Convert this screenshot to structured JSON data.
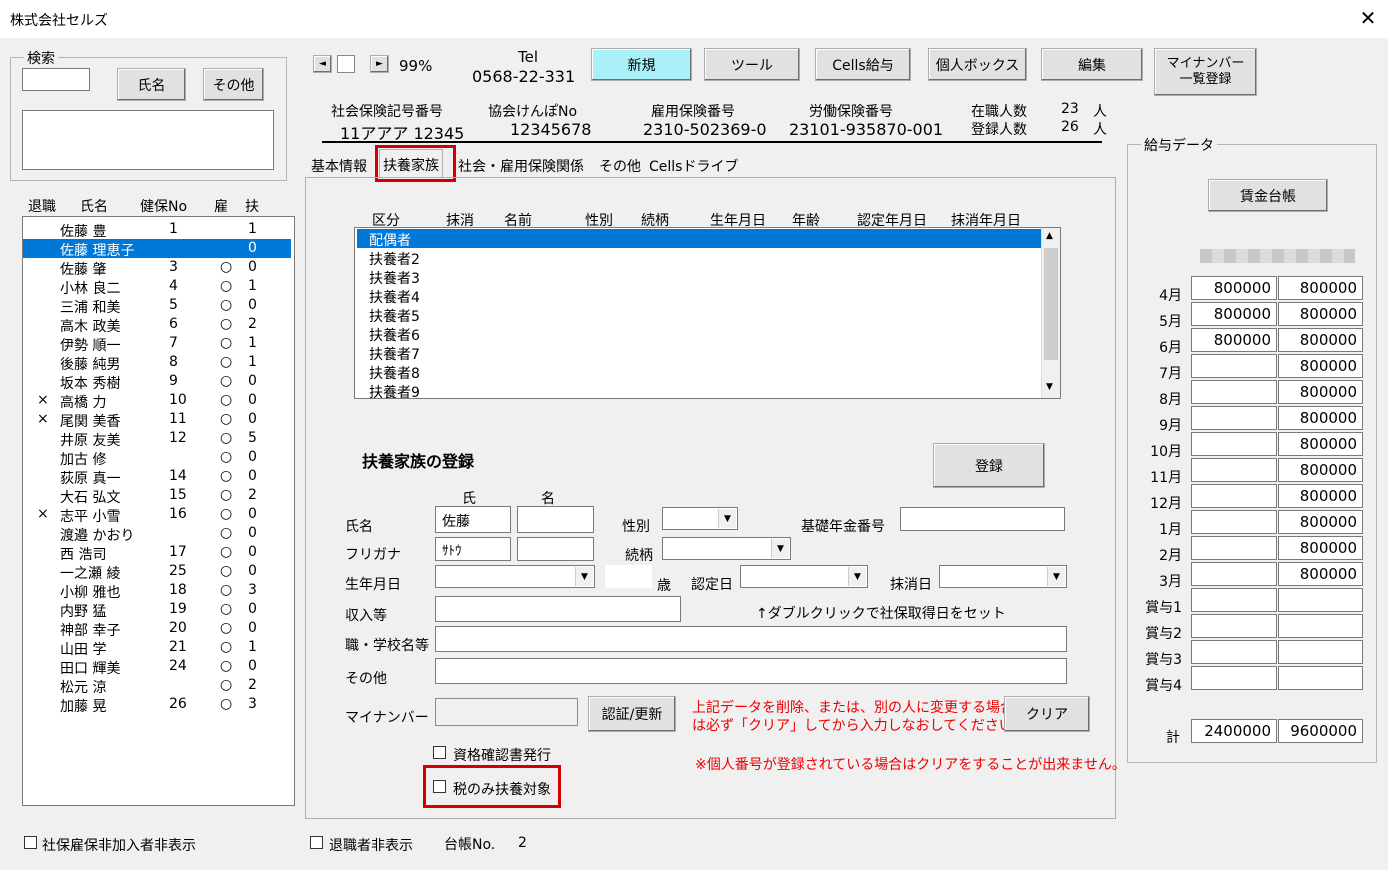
{
  "window": {
    "title": "株式会社セルズ",
    "close": "✕"
  },
  "search": {
    "legend": "検索",
    "value": "",
    "name_btn": "氏名",
    "other_btn": "その他",
    "memo": ""
  },
  "employee_list": {
    "headers": [
      "退職",
      "氏名",
      "健保No",
      "雇",
      "扶"
    ],
    "rows": [
      {
        "ret": "",
        "name": "佐藤 豊",
        "no": "1",
        "emp": "",
        "dep": "1",
        "sel": false
      },
      {
        "ret": "",
        "name": "佐藤 理恵子",
        "no": "",
        "emp": "",
        "dep": "0",
        "sel": true
      },
      {
        "ret": "",
        "name": "佐藤 肇",
        "no": "3",
        "emp": "○",
        "dep": "0",
        "sel": false
      },
      {
        "ret": "",
        "name": "小林 良二",
        "no": "4",
        "emp": "○",
        "dep": "1",
        "sel": false
      },
      {
        "ret": "",
        "name": "三浦 和美",
        "no": "5",
        "emp": "○",
        "dep": "0",
        "sel": false
      },
      {
        "ret": "",
        "name": "高木 政美",
        "no": "6",
        "emp": "○",
        "dep": "2",
        "sel": false
      },
      {
        "ret": "",
        "name": "伊勢 順一",
        "no": "7",
        "emp": "○",
        "dep": "1",
        "sel": false
      },
      {
        "ret": "",
        "name": "後藤 純男",
        "no": "8",
        "emp": "○",
        "dep": "1",
        "sel": false
      },
      {
        "ret": "",
        "name": "坂本 秀樹",
        "no": "9",
        "emp": "○",
        "dep": "0",
        "sel": false
      },
      {
        "ret": "×",
        "name": "高橋 力",
        "no": "10",
        "emp": "○",
        "dep": "0",
        "sel": false
      },
      {
        "ret": "×",
        "name": "尾関 美香",
        "no": "11",
        "emp": "○",
        "dep": "0",
        "sel": false
      },
      {
        "ret": "",
        "name": "井原 友美",
        "no": "12",
        "emp": "○",
        "dep": "5",
        "sel": false
      },
      {
        "ret": "",
        "name": "加古 修",
        "no": "",
        "emp": "○",
        "dep": "0",
        "sel": false
      },
      {
        "ret": "",
        "name": "荻原 真一",
        "no": "14",
        "emp": "○",
        "dep": "0",
        "sel": false
      },
      {
        "ret": "",
        "name": "大石 弘文",
        "no": "15",
        "emp": "○",
        "dep": "2",
        "sel": false
      },
      {
        "ret": "×",
        "name": "志平 小雪",
        "no": "16",
        "emp": "○",
        "dep": "0",
        "sel": false
      },
      {
        "ret": "",
        "name": "渡邉 かおり",
        "no": "",
        "emp": "○",
        "dep": "0",
        "sel": false
      },
      {
        "ret": "",
        "name": "西 浩司",
        "no": "17",
        "emp": "○",
        "dep": "0",
        "sel": false
      },
      {
        "ret": "",
        "name": "一之瀬 綾",
        "no": "25",
        "emp": "○",
        "dep": "0",
        "sel": false
      },
      {
        "ret": "",
        "name": "小柳 雅也",
        "no": "18",
        "emp": "○",
        "dep": "3",
        "sel": false
      },
      {
        "ret": "",
        "name": "内野 猛",
        "no": "19",
        "emp": "○",
        "dep": "0",
        "sel": false
      },
      {
        "ret": "",
        "name": "神部 幸子",
        "no": "20",
        "emp": "○",
        "dep": "0",
        "sel": false
      },
      {
        "ret": "",
        "name": "山田 学",
        "no": "21",
        "emp": "○",
        "dep": "1",
        "sel": false
      },
      {
        "ret": "",
        "name": "田口 輝美",
        "no": "24",
        "emp": "○",
        "dep": "0",
        "sel": false
      },
      {
        "ret": "",
        "name": "松元 涼",
        "no": "",
        "emp": "○",
        "dep": "2",
        "sel": false
      },
      {
        "ret": "",
        "name": "加藤 晃",
        "no": "26",
        "emp": "○",
        "dep": "3",
        "sel": false
      }
    ]
  },
  "nav": {
    "zoom": "99%",
    "left": "◄",
    "right": "►"
  },
  "tel": {
    "label": "Tel",
    "value": "0568-22-331"
  },
  "toolbar": {
    "new": "新規",
    "tools": "ツール",
    "cells": "Cells給与",
    "personal": "個人ボックス",
    "edit": "編集",
    "mynumber_line1": "マイナンバー",
    "mynumber_line2": "一覧登録"
  },
  "info": {
    "social_label": "社会保険記号番号",
    "social_value": "11アアア 12345",
    "kenpo_label": "協会けんぽNo",
    "kenpo_value": "12345678",
    "koyou_label": "雇用保険番号",
    "koyou_value": "2310-502369-0",
    "roudou_label": "労働保険番号",
    "roudou_value": "23101-935870-001",
    "zaishoku_label": "在職人数",
    "zaishoku_value": "23",
    "zaishoku_unit": "人",
    "touroku_label": "登録人数",
    "touroku_value": "26",
    "touroku_unit": "人"
  },
  "tabs": [
    "基本情報",
    "扶養家族",
    "社会・雇用保険関係",
    "その他",
    "Cellsドライブ"
  ],
  "dependents": {
    "headers": [
      "区分",
      "抹消",
      "名前",
      "性別",
      "続柄",
      "生年月日",
      "年齢",
      "認定年月日",
      "抹消年月日"
    ],
    "rows": [
      "配偶者",
      "扶養者2",
      "扶養者3",
      "扶養者4",
      "扶養者5",
      "扶養者6",
      "扶養者7",
      "扶養者8",
      "扶養者9"
    ]
  },
  "register": {
    "heading": "扶養家族の登録",
    "register_btn": "登録",
    "sei_label": "氏",
    "mei_label": "名",
    "name_label": "氏名",
    "sei": "佐藤",
    "mei": "",
    "furigana_label": "フリガナ",
    "furi_sei": "ｻﾄｳ",
    "furi_mei": "",
    "gender_label": "性別",
    "relation_label": "続柄",
    "pension_label": "基礎年金番号",
    "birth_label": "生年月日",
    "age_unit": "歳",
    "nintei_label": "認定日",
    "massho_label": "抹消日",
    "income_label": "収入等",
    "hint": "↑ダブルクリックで社保取得日をセット",
    "job_label": "職・学校名等",
    "other_label": "その他",
    "mynumber_label": "マイナンバー",
    "auth_btn": "認証/更新",
    "warn1_line1": "上記データを削除、または、別の人に変更する場合",
    "warn1_line2": "は必ず「クリア」してから入力しなおしてください⇒⇒",
    "clear_btn": "クリア",
    "warn2": "※個人番号が登録されている場合はクリアをすることが出来ません。",
    "cert_label": "資格確認書発行",
    "tax_label": "税のみ扶養対象"
  },
  "salary": {
    "legend": "給与データ",
    "ledger_btn": "賃金台帳",
    "months": [
      "4月",
      "5月",
      "6月",
      "7月",
      "8月",
      "9月",
      "10月",
      "11月",
      "12月",
      "1月",
      "2月",
      "3月",
      "賞与1",
      "賞与2",
      "賞与3",
      "賞与4"
    ],
    "col1": [
      "800000",
      "800000",
      "800000",
      "",
      "",
      "",
      "",
      "",
      "",
      "",
      "",
      "",
      "",
      "",
      "",
      ""
    ],
    "col2": [
      "800000",
      "800000",
      "800000",
      "800000",
      "800000",
      "800000",
      "800000",
      "800000",
      "800000",
      "800000",
      "800000",
      "800000",
      "",
      "",
      "",
      ""
    ],
    "total_label": "計",
    "total1": "2400000",
    "total2": "9600000"
  },
  "bottom": {
    "hide_social": "社保雇保非加入者非表示",
    "hide_retired": "退職者非表示",
    "ledger_label": "台帳No.",
    "ledger_no": "2"
  }
}
